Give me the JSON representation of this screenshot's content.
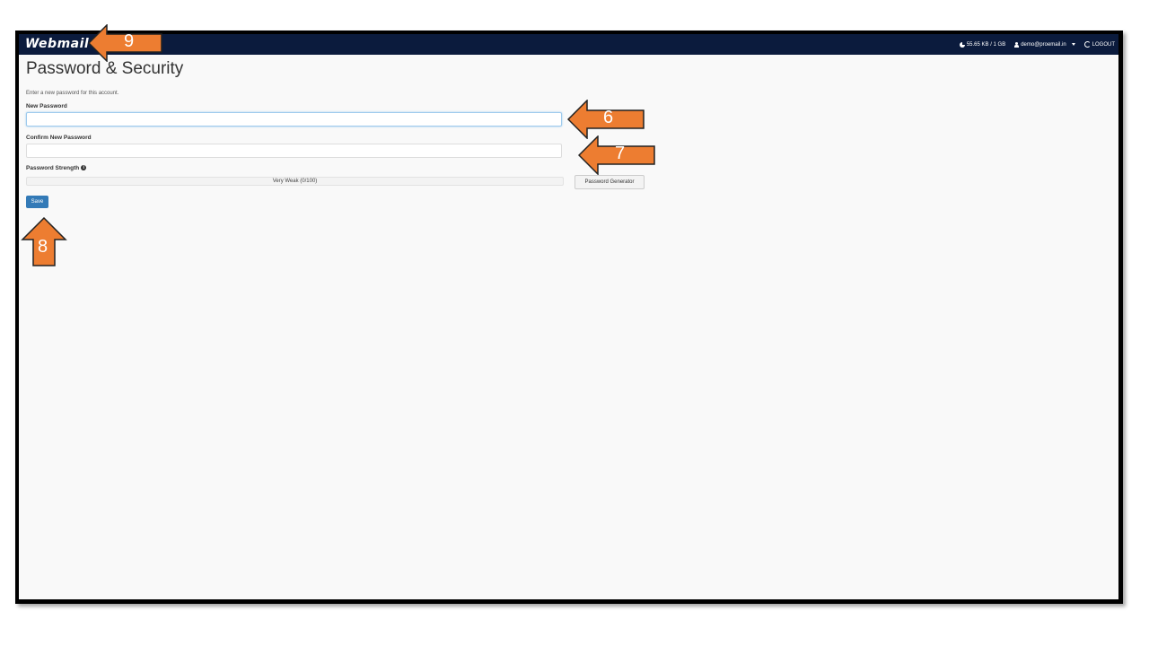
{
  "app": {
    "logo": "Webmail",
    "disk_usage": "55.65 KB / 1 GB",
    "user": "demo@proemail.in",
    "logout": "LOGOUT"
  },
  "page": {
    "title": "Password & Security",
    "description": "Enter a new password for this account.",
    "new_password_label": "New Password",
    "confirm_password_label": "Confirm New Password",
    "strength_label": "Password Strength",
    "strength_value": "Very Weak (0/100)",
    "generator_button": "Password Generator",
    "save_button": "Save"
  },
  "annotations": {
    "arrow_6": "6",
    "arrow_7": "7",
    "arrow_8": "8",
    "arrow_9": "9",
    "color": "#ED7D31"
  }
}
